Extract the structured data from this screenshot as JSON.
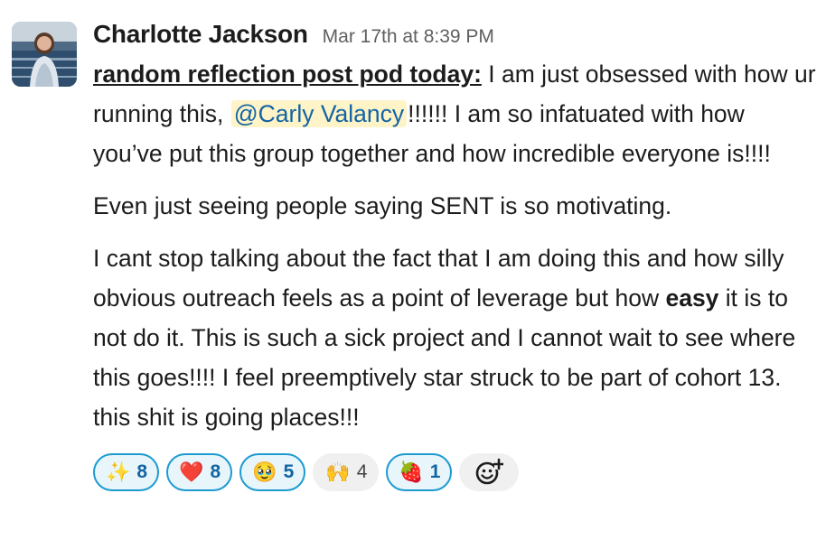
{
  "message": {
    "author": "Charlotte Jackson",
    "timestamp": "Mar 17th at 8:39 PM",
    "lead_label": "random reflection post pod today:",
    "p1_after_lead": " I am just obsessed with how ur running this, ",
    "mention": "@Carly Valancy",
    "p1_after_mention": "!!!!!! I am so infatuated with how you’ve put this group together and how incredible everyone is!!!!",
    "p2": "Even just seeing people saying SENT is so motivating.",
    "p3_before_bold": "I cant stop talking about the fact that I am doing this and how silly obvious outreach feels as a point of leverage but how ",
    "p3_bold": "easy",
    "p3_after_bold": " it is to not do it. This is such a sick project and I cannot wait to see where this goes!!!! I feel preemptively star struck to be part of cohort 13. this shit is going places!!!"
  },
  "reactions": [
    {
      "emoji": "✨",
      "name": "sparkles",
      "count": "8",
      "mine": true
    },
    {
      "emoji": "❤️",
      "name": "heart",
      "count": "8",
      "mine": true
    },
    {
      "emoji": "🥹",
      "name": "holding-back-tears",
      "count": "5",
      "mine": true
    },
    {
      "emoji": "🙌",
      "name": "raised-hands",
      "count": "4",
      "mine": false
    },
    {
      "emoji": "🍓",
      "name": "strawberry",
      "count": "1",
      "mine": true
    }
  ],
  "icons": {
    "add_reaction": "add-reaction-icon"
  },
  "colors": {
    "mention_bg": "#fff3c8",
    "mention_text": "#1264a3",
    "reaction_border": "#1d9bd1"
  }
}
